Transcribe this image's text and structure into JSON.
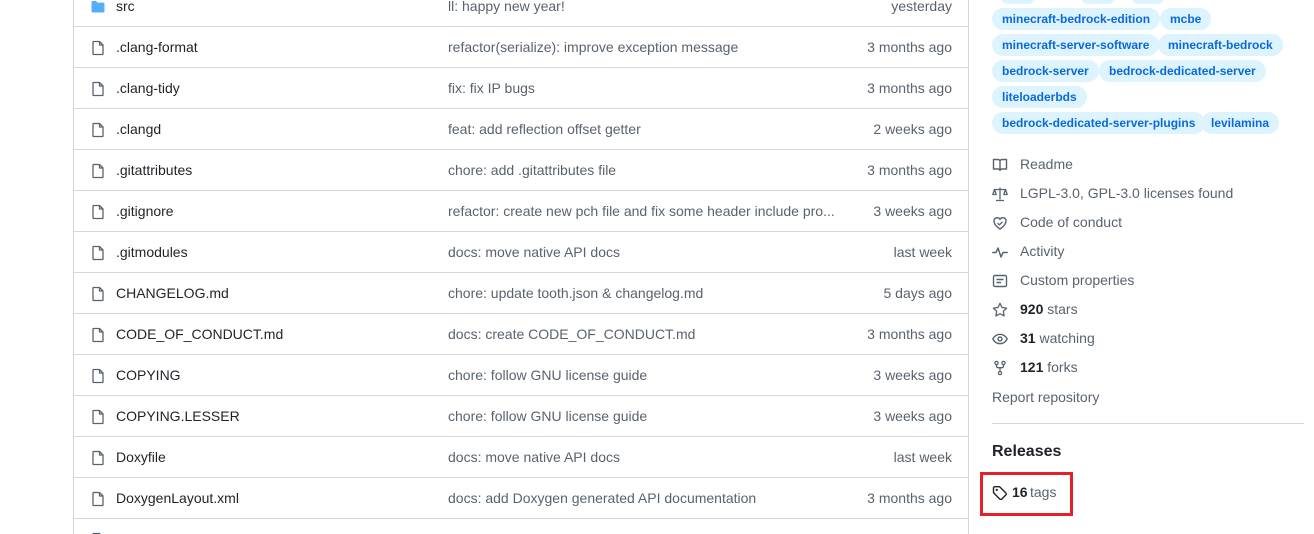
{
  "files": [
    {
      "type": "folder",
      "name": "src",
      "message": "ll: happy new year!",
      "date": "yesterday"
    },
    {
      "type": "file",
      "name": ".clang-format",
      "message": "refactor(serialize): improve exception message",
      "date": "3 months ago"
    },
    {
      "type": "file",
      "name": ".clang-tidy",
      "message": "fix: fix IP bugs",
      "date": "3 months ago"
    },
    {
      "type": "file",
      "name": ".clangd",
      "message": "feat: add reflection offset getter",
      "date": "2 weeks ago"
    },
    {
      "type": "file",
      "name": ".gitattributes",
      "message": "chore: add .gitattributes file",
      "date": "3 months ago"
    },
    {
      "type": "file",
      "name": ".gitignore",
      "message": "refactor: create new pch file and fix some header include pro...",
      "date": "3 weeks ago"
    },
    {
      "type": "file",
      "name": ".gitmodules",
      "message": "docs: move native API docs",
      "date": "last week"
    },
    {
      "type": "file",
      "name": "CHANGELOG.md",
      "message": "chore: update tooth.json & changelog.md",
      "date": "5 days ago"
    },
    {
      "type": "file",
      "name": "CODE_OF_CONDUCT.md",
      "message": "docs: create CODE_OF_CONDUCT.md",
      "date": "3 months ago"
    },
    {
      "type": "file",
      "name": "COPYING",
      "message": "chore: follow GNU license guide",
      "date": "3 weeks ago"
    },
    {
      "type": "file",
      "name": "COPYING.LESSER",
      "message": "chore: follow GNU license guide",
      "date": "3 weeks ago"
    },
    {
      "type": "file",
      "name": "Doxyfile",
      "message": "docs: move native API docs",
      "date": "last week"
    },
    {
      "type": "file",
      "name": "DoxygenLayout.xml",
      "message": "docs: add Doxygen generated API documentation",
      "date": "3 months ago"
    }
  ],
  "topics": [
    "minecraft-bedrock-edition",
    "mcbe",
    "minecraft-server-software",
    "minecraft-bedrock",
    "bedrock-server",
    "bedrock-dedicated-server",
    "liteloaderbds",
    "bedrock-dedicated-server-plugins",
    "levilamina"
  ],
  "about": {
    "readme": "Readme",
    "license": "LGPL-3.0, GPL-3.0 licenses found",
    "conduct": "Code of conduct",
    "activity": "Activity",
    "custom_properties": "Custom properties",
    "stars_count": "920",
    "stars_label": "stars",
    "watching_count": "31",
    "watching_label": "watching",
    "forks_count": "121",
    "forks_label": "forks",
    "report": "Report repository"
  },
  "releases": {
    "title": "Releases",
    "tags_count": "16",
    "tags_label": "tags"
  },
  "colors": {
    "link_blue": "#0969da",
    "topic_bg": "#ddf4ff",
    "folder_blue": "#54aeff",
    "muted": "#59636e",
    "highlight_red": "#e5202a"
  },
  "icons": {
    "folder": "folder-icon",
    "file": "file-icon",
    "readme": "book-icon",
    "license": "law-scale-icon",
    "conduct": "code-of-conduct-icon",
    "activity": "pulse-icon",
    "custom_properties": "note-icon",
    "stars": "star-icon",
    "watching": "eye-icon",
    "forks": "fork-icon",
    "tags": "tag-icon"
  }
}
